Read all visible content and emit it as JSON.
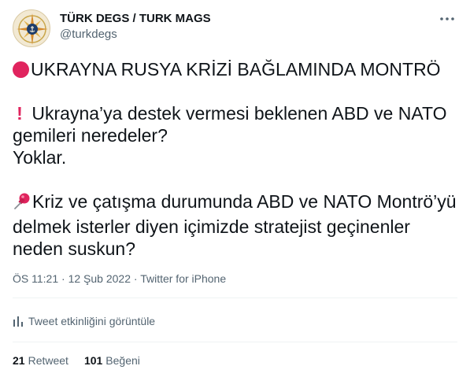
{
  "author": {
    "display_name": "TÜRK DEGS / TURK MAGS",
    "handle": "@turkdegs"
  },
  "more_icon": "more-dots-icon",
  "tweet": {
    "p1": {
      "icon": "red-circle-icon",
      "text": "UKRAYNA RUSYA KRİZİ BAĞLAMINDA MONTRÖ"
    },
    "p2": {
      "icon": "exclamation-icon",
      "exclaim": "!",
      "line1": " Ukrayna’ya destek vermesi beklenen ABD ve NATO",
      "line2": "gemileri neredeler?",
      "line3": "Yoklar."
    },
    "p3": {
      "icon": "pushpin-icon",
      "line1": "Kriz ve çatışma durumunda ABD ve NATO Montrö’yü",
      "line2": "delmek isterler diyen içimizde stratejist geçinenler",
      "line3": "neden suskun?"
    }
  },
  "meta": {
    "time": "ÖS 11:21",
    "sep1": " · ",
    "date": "12 Şub 2022",
    "sep2": " · ",
    "source": "Twitter for iPhone"
  },
  "activity": {
    "icon": "bar-chart-icon",
    "label": "Tweet etkinliğini görüntüle"
  },
  "stats": {
    "retweets": {
      "count": "21",
      "label": "Retweet"
    },
    "likes": {
      "count": "101",
      "label": "Beğeni"
    }
  },
  "colors": {
    "red": "#e0245e",
    "secondary_text": "#536471",
    "divider": "#eff3f4"
  }
}
